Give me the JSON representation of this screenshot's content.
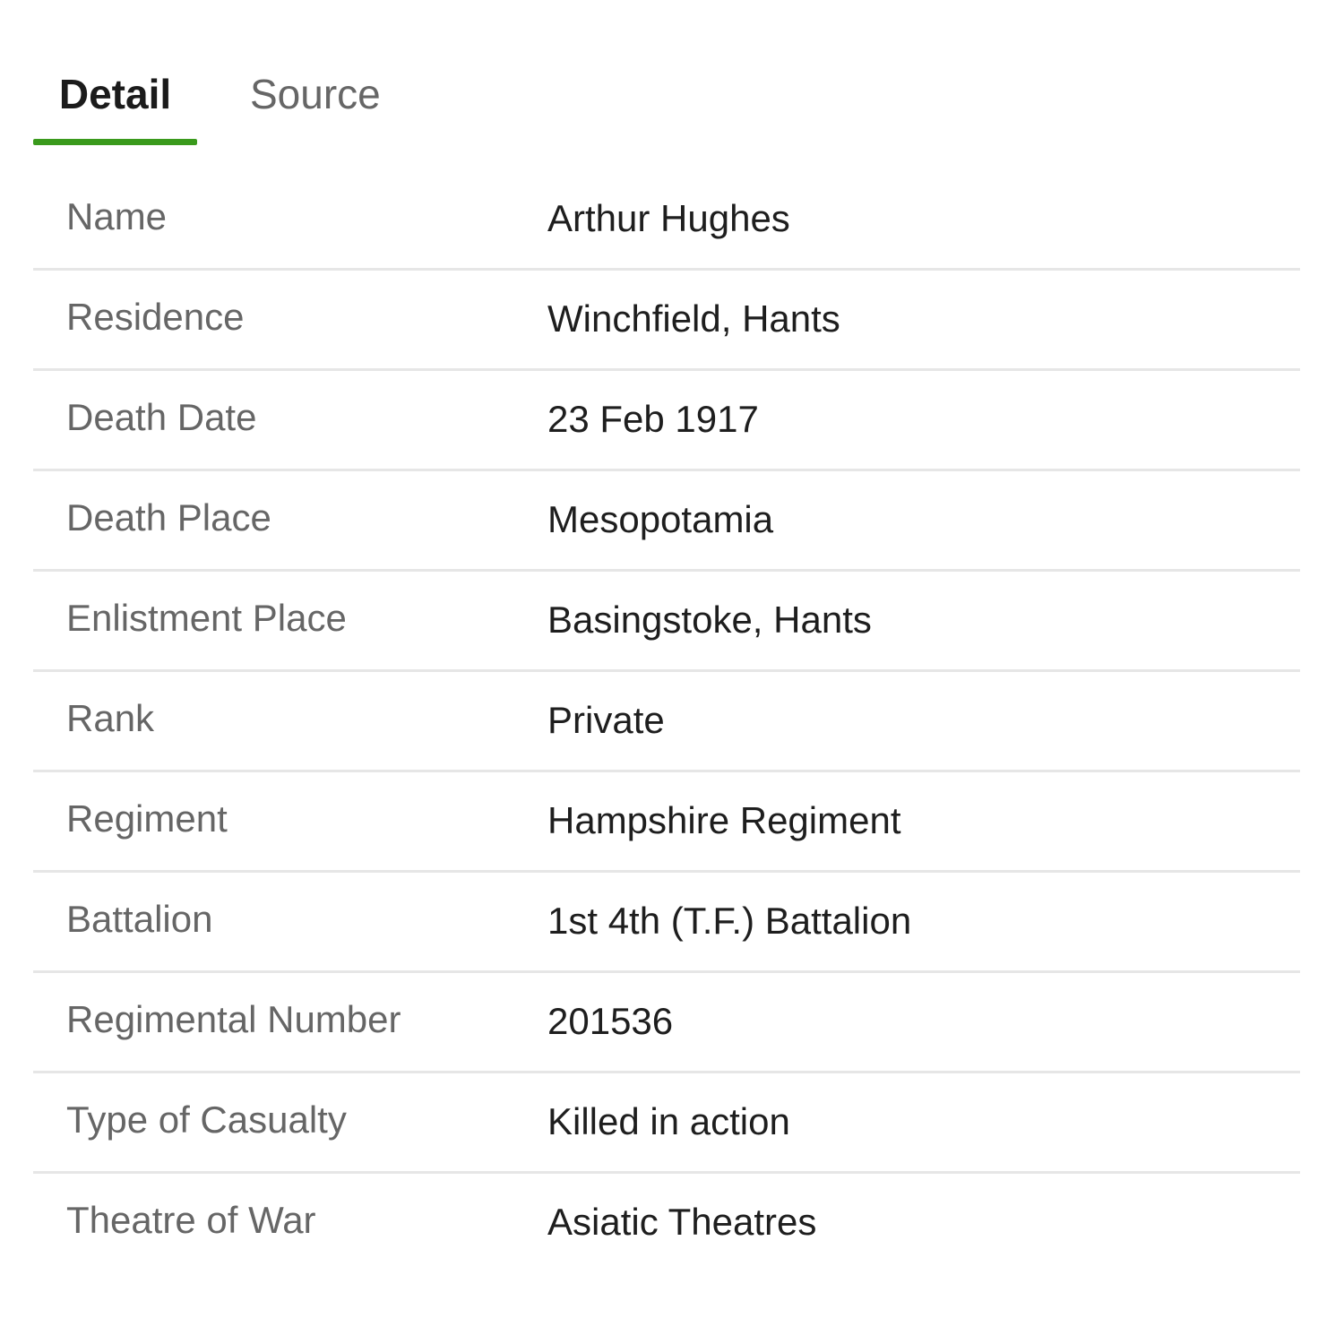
{
  "tabs": {
    "detail_label": "Detail",
    "source_label": "Source",
    "active_color": "#3a9a1c"
  },
  "record": [
    {
      "label": "Name",
      "value": "Arthur Hughes"
    },
    {
      "label": "Residence",
      "value": "Winchfield, Hants"
    },
    {
      "label": "Death Date",
      "value": "23 Feb 1917"
    },
    {
      "label": "Death Place",
      "value": "Mesopotamia"
    },
    {
      "label": "Enlistment Place",
      "value": "Basingstoke, Hants"
    },
    {
      "label": "Rank",
      "value": "Private"
    },
    {
      "label": "Regiment",
      "value": "Hampshire Regiment"
    },
    {
      "label": "Battalion",
      "value": "1st 4th (T.F.) Battalion"
    },
    {
      "label": "Regimental Number",
      "value": "201536"
    },
    {
      "label": "Type of Casualty",
      "value": "Killed in action"
    },
    {
      "label": "Theatre of War",
      "value": "Asiatic Theatres"
    }
  ]
}
